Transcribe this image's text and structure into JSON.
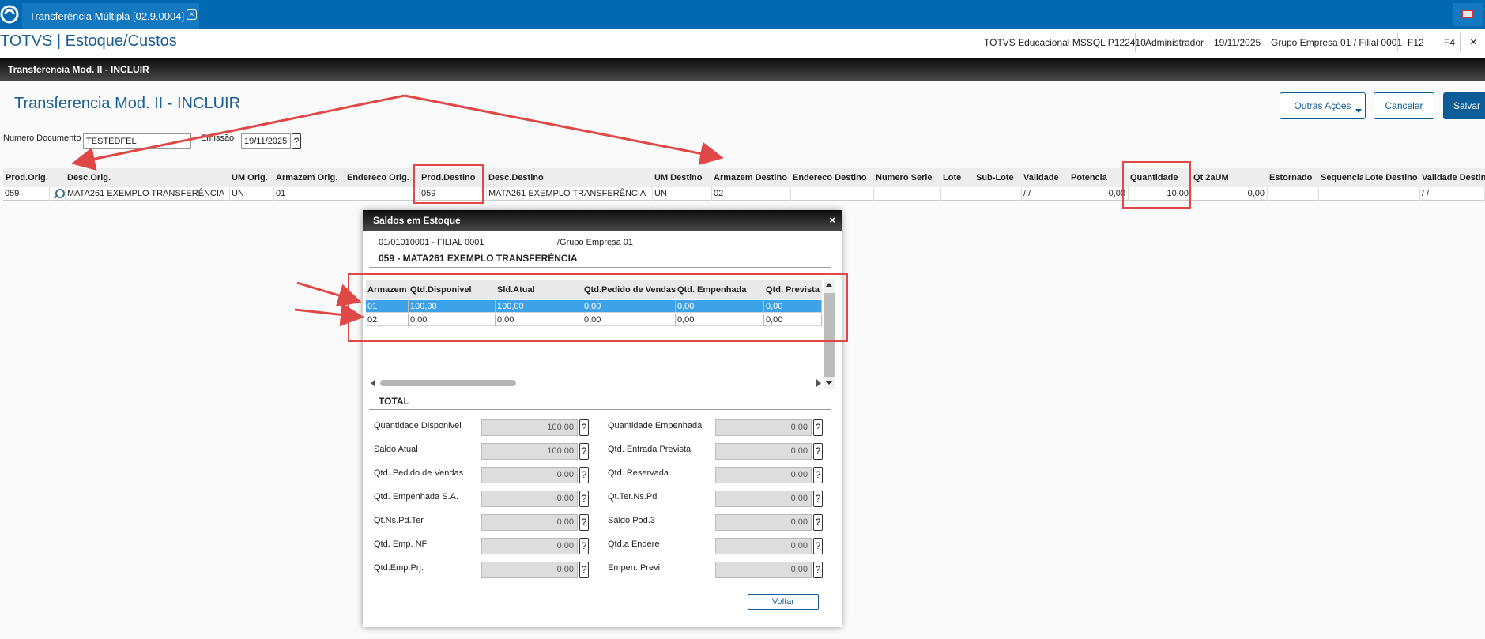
{
  "tabbar": {
    "tab_label": "Transferência Múltipla [02.9.0004]",
    "tab_close": "×"
  },
  "header": {
    "app_title": "TOTVS | Estoque/Custos",
    "environment": "TOTVS Educacional MSSQL P122410",
    "user": "Administrador",
    "date": "19/11/2025",
    "branch": "Grupo Empresa 01 / Filial 0001",
    "f12": "F12",
    "f4": "F4",
    "close": "×"
  },
  "window": {
    "bar_title": "Transferencia Mod. II - INCLUIR",
    "form_title": "Transferencia Mod. II - INCLUIR"
  },
  "actions": {
    "outras": "Outras Ações",
    "cancelar": "Cancelar",
    "salvar": "Salvar"
  },
  "form": {
    "numero_label": "Numero Documento",
    "numero_value": "TESTEDFEL",
    "emissao_label": "Emissão",
    "emissao_value": "19/11/2025",
    "help": "?"
  },
  "grid": {
    "headers": [
      "Prod.Orig.",
      "Desc.Orig.",
      "UM Orig.",
      "Armazem Orig.",
      "Endereco Orig.",
      "Prod.Destino",
      "Desc.Destino",
      "UM Destino",
      "Armazem Destino",
      "Endereco Destino",
      "Numero Serie",
      "Lote",
      "Sub-Lote",
      "Validade",
      "Potencia",
      "Quantidade",
      "Qt 2aUM",
      "Estornado",
      "Sequencia",
      "Lote Destino",
      "Validade Destino"
    ],
    "row": [
      "059",
      "MATA261 EXEMPLO TRANSFERÊNCIA",
      "UN",
      "01",
      "",
      "059",
      "MATA261 EXEMPLO TRANSFERÊNCIA",
      "UN",
      "02",
      "",
      "",
      "",
      "",
      "/ /",
      "0,00",
      "10,00",
      "0,00",
      "",
      "",
      "",
      "/ /"
    ]
  },
  "modal": {
    "title": "Saldos em Estoque",
    "close": "×",
    "filial": "01/01010001 - FILIAL 0001",
    "grupo": "/Grupo Empresa 01",
    "produto": "059 - MATA261 EXEMPLO TRANSFERÊNCIA",
    "table_headers": [
      "Armazem",
      "Qtd.Disponivel",
      "Sld.Atual",
      "Qtd.Pedido de Vendas",
      "Qtd. Empenhada",
      "Qtd. Prevista"
    ],
    "rows": [
      [
        "01",
        "100,00",
        "100,00",
        "0,00",
        "0,00",
        "0,00"
      ],
      [
        "02",
        "0,00",
        "0,00",
        "0,00",
        "0,00",
        "0,00"
      ]
    ],
    "total_label": "TOTAL",
    "totals_left": [
      {
        "label": "Quantidade Disponivel",
        "value": "100,00"
      },
      {
        "label": "Saldo Atual",
        "value": "100,00"
      },
      {
        "label": "Qtd. Pedido de Vendas",
        "value": "0,00"
      },
      {
        "label": "Qtd. Empenhada S.A.",
        "value": "0,00"
      },
      {
        "label": "Qt.Ns.Pd.Ter",
        "value": "0,00"
      },
      {
        "label": "Qtd. Emp. NF",
        "value": "0,00"
      },
      {
        "label": "Qtd.Emp.Prj.",
        "value": "0,00"
      }
    ],
    "totals_right": [
      {
        "label": "Quantidade Empenhada",
        "value": "0,00"
      },
      {
        "label": "Qtd. Entrada Prevista",
        "value": "0,00"
      },
      {
        "label": "Qtd. Reservada",
        "value": "0,00"
      },
      {
        "label": "Qt.Ter.Ns.Pd",
        "value": "0,00"
      },
      {
        "label": "Saldo Pod.3",
        "value": "0,00"
      },
      {
        "label": "Qtd.a Endere",
        "value": "0,00"
      },
      {
        "label": "Empen. Previ",
        "value": "0,00"
      }
    ],
    "help": "?",
    "voltar": "Voltar"
  },
  "colors": {
    "brand_blue": "#0069b1",
    "annotation_red": "#e04848",
    "selected_row": "#3ea2e8"
  }
}
